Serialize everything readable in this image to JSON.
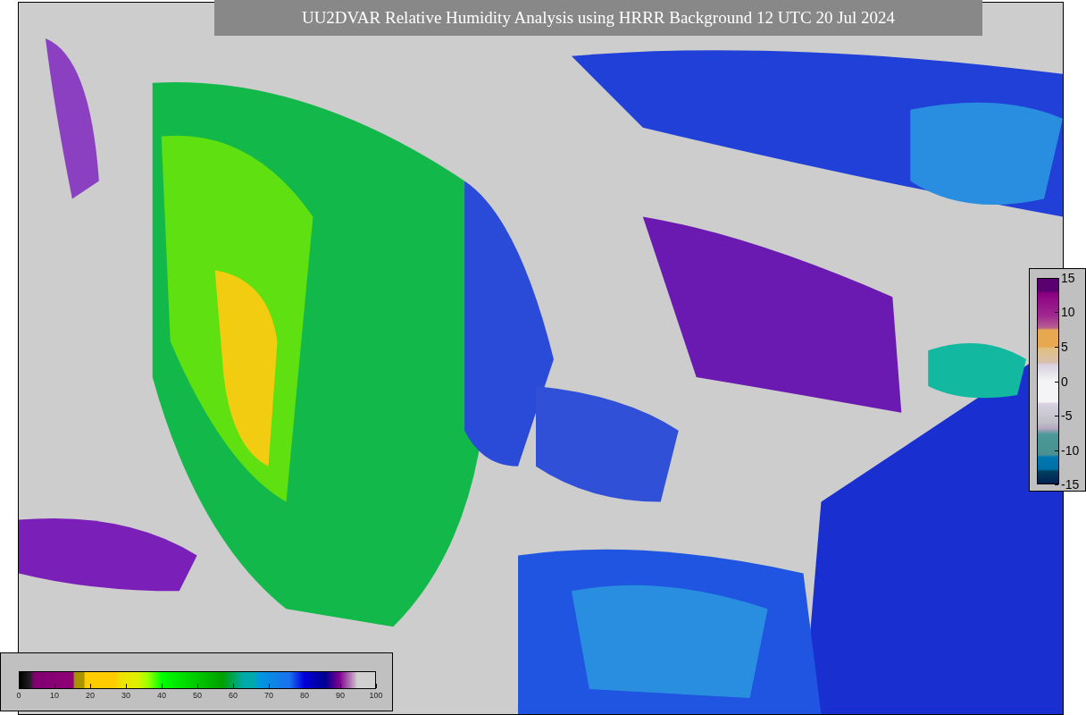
{
  "title": "UU2DVAR Relative Humidity Analysis using HRRR Background 12 UTC 20 Jul 2024",
  "humidity_colorbar": {
    "ticks": [
      "0",
      "10",
      "20",
      "30",
      "40",
      "50",
      "60",
      "70",
      "80",
      "90",
      "100"
    ]
  },
  "difference_colorbar": {
    "ticks": [
      "15",
      "10",
      "5",
      "0",
      "-5",
      "-10",
      "-15"
    ]
  }
}
